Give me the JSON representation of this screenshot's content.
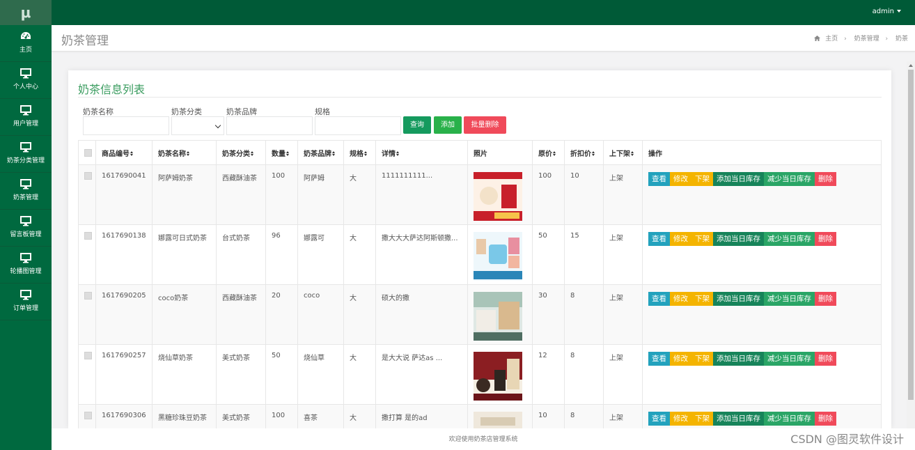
{
  "app": {
    "logo": "μ",
    "user": "admin"
  },
  "sidebar": {
    "items": [
      {
        "label": "主页",
        "icon": "dashboard-icon"
      },
      {
        "label": "个人中心",
        "icon": "monitor-icon"
      },
      {
        "label": "用户管理",
        "icon": "monitor-icon"
      },
      {
        "label": "奶茶分类管理",
        "icon": "monitor-icon"
      },
      {
        "label": "奶茶管理",
        "icon": "monitor-icon"
      },
      {
        "label": "留言板管理",
        "icon": "monitor-icon"
      },
      {
        "label": "轮播图管理",
        "icon": "monitor-icon"
      },
      {
        "label": "订单管理",
        "icon": "monitor-icon"
      }
    ]
  },
  "header": {
    "title": "奶茶管理",
    "breadcrumb": [
      "主页",
      "奶茶管理",
      "奶茶"
    ]
  },
  "panel": {
    "title": "奶茶信息列表",
    "filters": {
      "name_label": "奶茶名称",
      "category_label": "奶茶分类",
      "brand_label": "奶茶品牌",
      "spec_label": "规格",
      "name_value": "",
      "category_value": "",
      "brand_value": "",
      "spec_value": ""
    },
    "buttons": {
      "search": "查询",
      "add": "添加",
      "batch_delete": "批量删除"
    }
  },
  "table": {
    "headers": [
      "商品编号",
      "奶茶名称",
      "奶茶分类",
      "数量",
      "奶茶品牌",
      "规格",
      "详情",
      "照片",
      "原价",
      "折扣价",
      "上下架",
      "操作"
    ],
    "actions": [
      "查看",
      "修改",
      "下架",
      "添加当日库存",
      "减少当日库存",
      "删除"
    ],
    "rows": [
      {
        "id": "1617690041",
        "name": "阿萨姆奶茶",
        "category": "西藏酥油茶",
        "qty": "100",
        "brand": "阿萨姆",
        "spec": "大",
        "detail": "1111111111...",
        "price": "100",
        "discount": "10",
        "status": "上架"
      },
      {
        "id": "1617690138",
        "name": "娜露可日式奶茶",
        "category": "台式奶茶",
        "qty": "96",
        "brand": "娜露可",
        "spec": "大",
        "detail": "撒大大大萨达阿斯顿撒...",
        "price": "50",
        "discount": "15",
        "status": "上架"
      },
      {
        "id": "1617690205",
        "name": "coco奶茶",
        "category": "西藏酥油茶",
        "qty": "20",
        "brand": "coco",
        "spec": "大",
        "detail": "硕大的撒",
        "price": "30",
        "discount": "8",
        "status": "上架"
      },
      {
        "id": "1617690257",
        "name": "烧仙草奶茶",
        "category": "美式奶茶",
        "qty": "50",
        "brand": "烧仙草",
        "spec": "大",
        "detail": "是大大说 萨达as ...",
        "price": "12",
        "discount": "8",
        "status": "上架"
      },
      {
        "id": "1617690306",
        "name": "黑糖珍珠豆奶茶",
        "category": "美式奶茶",
        "qty": "100",
        "brand": "喜茶",
        "spec": "大",
        "detail": "撒打算 是的ad",
        "price": "10",
        "discount": "8",
        "status": "上架"
      }
    ]
  },
  "footer": {
    "text": "欢迎使用奶茶店管理系统"
  },
  "watermark": "CSDN @图灵软件设计",
  "colors": {
    "topbar": "#005a37",
    "sidebar": "#00693f",
    "view": "#23a2bd",
    "edit": "#f4b400",
    "stock_add": "#17845a",
    "stock_sub": "#2aa566",
    "delete": "#f04a5a",
    "search": "#159a5e",
    "add": "#29b14a",
    "batch_delete": "#f04a5a"
  }
}
